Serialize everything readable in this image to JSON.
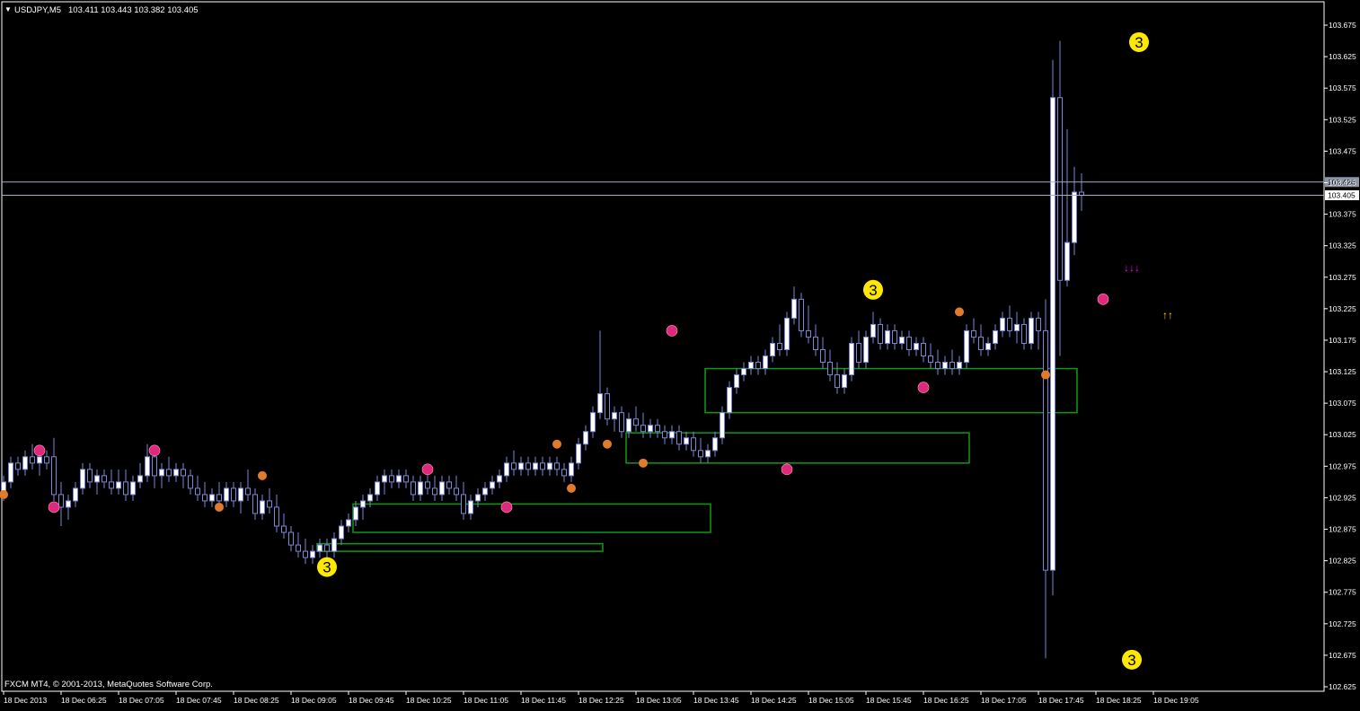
{
  "header": {
    "menu_glyph": "▼",
    "symbol": "USDJPY,M5",
    "quote": "103.411 103.443 103.382 103.405"
  },
  "footer": {
    "copyright": "FXCM MT4, © 2001-2013, MetaQuotes Software Corp."
  },
  "colors": {
    "background": "#000000",
    "grid_frame": "#ffffff",
    "candle": "#7d86d6",
    "bull_body": "#ffffff",
    "hline": "#a4b0c8",
    "zone": "#0c9a15",
    "wave_label": "#ffe800",
    "marker_pink": "#e0287c",
    "marker_orange": "#e07a2c",
    "arrow_down": "#ff00ff",
    "arrow_up": "#ffd400",
    "ask_label_bg": "#8c96a8",
    "bid_label_bg": "#ffffff"
  },
  "chart_data": {
    "type": "candlestick",
    "symbol": "USDJPY",
    "timeframe": "M5",
    "ylim": [
      102.625,
      103.7
    ],
    "y_ticks": [
      "103.675",
      "103.625",
      "103.575",
      "103.525",
      "103.475",
      "103.425",
      "103.375",
      "103.325",
      "103.275",
      "103.225",
      "103.175",
      "103.125",
      "103.075",
      "103.025",
      "102.975",
      "102.925",
      "102.875",
      "102.825",
      "102.775",
      "102.725",
      "102.675",
      "102.625"
    ],
    "x_ticks": [
      "18 Dec 2013",
      "18 Dec 06:25",
      "18 Dec 07:05",
      "18 Dec 07:45",
      "18 Dec 08:25",
      "18 Dec 09:05",
      "18 Dec 09:45",
      "18 Dec 10:25",
      "18 Dec 11:05",
      "18 Dec 11:45",
      "18 Dec 12:25",
      "18 Dec 13:05",
      "18 Dec 13:45",
      "18 Dec 14:25",
      "18 Dec 15:05",
      "18 Dec 15:45",
      "18 Dec 16:25",
      "18 Dec 17:05",
      "18 Dec 17:45",
      "18 Dec 18:25",
      "18 Dec 19:05"
    ],
    "bars_per_tick": 8,
    "price_lines": [
      {
        "name": "ask",
        "value": 103.426,
        "label": "103.426"
      },
      {
        "name": "bid",
        "value": 103.405,
        "label": "103.405"
      }
    ],
    "ohlc": [
      [
        102.93,
        102.96,
        102.92,
        102.95
      ],
      [
        102.95,
        102.99,
        102.94,
        102.98
      ],
      [
        102.98,
        102.99,
        102.96,
        102.97
      ],
      [
        102.97,
        103.0,
        102.96,
        102.99
      ],
      [
        102.99,
        103.01,
        102.97,
        102.98
      ],
      [
        102.98,
        103.0,
        102.96,
        102.99
      ],
      [
        102.99,
        103.0,
        102.97,
        102.98
      ],
      [
        102.99,
        103.02,
        102.92,
        102.93
      ],
      [
        102.93,
        102.95,
        102.88,
        102.91
      ],
      [
        102.91,
        102.93,
        102.89,
        102.92
      ],
      [
        102.92,
        102.95,
        102.91,
        102.94
      ],
      [
        102.94,
        102.98,
        102.93,
        102.97
      ],
      [
        102.97,
        102.98,
        102.94,
        102.95
      ],
      [
        102.95,
        102.97,
        102.93,
        102.96
      ],
      [
        102.96,
        102.97,
        102.94,
        102.95
      ],
      [
        102.95,
        102.97,
        102.93,
        102.94
      ],
      [
        102.94,
        102.97,
        102.93,
        102.95
      ],
      [
        102.95,
        102.97,
        102.92,
        102.93
      ],
      [
        102.93,
        102.96,
        102.92,
        102.95
      ],
      [
        102.95,
        102.98,
        102.94,
        102.96
      ],
      [
        102.96,
        103.01,
        102.95,
        102.99
      ],
      [
        102.99,
        103.0,
        102.94,
        102.96
      ],
      [
        102.96,
        102.98,
        102.94,
        102.97
      ],
      [
        102.97,
        102.99,
        102.95,
        102.96
      ],
      [
        102.96,
        102.98,
        102.95,
        102.97
      ],
      [
        102.97,
        102.98,
        102.94,
        102.96
      ],
      [
        102.96,
        102.97,
        102.93,
        102.94
      ],
      [
        102.94,
        102.96,
        102.92,
        102.93
      ],
      [
        102.93,
        102.95,
        102.91,
        102.92
      ],
      [
        102.92,
        102.94,
        102.91,
        102.93
      ],
      [
        102.93,
        102.95,
        102.91,
        102.92
      ],
      [
        102.92,
        102.95,
        102.91,
        102.94
      ],
      [
        102.94,
        102.95,
        102.91,
        102.92
      ],
      [
        102.92,
        102.95,
        102.9,
        102.94
      ],
      [
        102.94,
        102.97,
        102.92,
        102.93
      ],
      [
        102.93,
        102.94,
        102.89,
        102.9
      ],
      [
        102.9,
        102.93,
        102.89,
        102.92
      ],
      [
        102.92,
        102.94,
        102.9,
        102.91
      ],
      [
        102.91,
        102.93,
        102.87,
        102.88
      ],
      [
        102.88,
        102.9,
        102.86,
        102.87
      ],
      [
        102.87,
        102.88,
        102.84,
        102.85
      ],
      [
        102.85,
        102.87,
        102.83,
        102.84
      ],
      [
        102.84,
        102.86,
        102.82,
        102.83
      ],
      [
        102.83,
        102.85,
        102.82,
        102.84
      ],
      [
        102.84,
        102.86,
        102.83,
        102.85
      ],
      [
        102.85,
        102.86,
        102.83,
        102.84
      ],
      [
        102.84,
        102.87,
        102.83,
        102.86
      ],
      [
        102.86,
        102.89,
        102.85,
        102.88
      ],
      [
        102.88,
        102.9,
        102.87,
        102.89
      ],
      [
        102.89,
        102.92,
        102.88,
        102.91
      ],
      [
        102.91,
        102.93,
        102.89,
        102.92
      ],
      [
        102.92,
        102.94,
        102.91,
        102.93
      ],
      [
        102.93,
        102.96,
        102.92,
        102.95
      ],
      [
        102.95,
        102.97,
        102.93,
        102.96
      ],
      [
        102.96,
        102.97,
        102.94,
        102.95
      ],
      [
        102.95,
        102.97,
        102.94,
        102.96
      ],
      [
        102.96,
        102.97,
        102.94,
        102.95
      ],
      [
        102.95,
        102.96,
        102.92,
        102.93
      ],
      [
        102.93,
        102.96,
        102.92,
        102.95
      ],
      [
        102.95,
        102.97,
        102.93,
        102.94
      ],
      [
        102.94,
        102.96,
        102.92,
        102.93
      ],
      [
        102.93,
        102.96,
        102.92,
        102.95
      ],
      [
        102.95,
        102.96,
        102.93,
        102.94
      ],
      [
        102.94,
        102.96,
        102.92,
        102.93
      ],
      [
        102.93,
        102.95,
        102.89,
        102.9
      ],
      [
        102.9,
        102.93,
        102.89,
        102.92
      ],
      [
        102.92,
        102.94,
        102.91,
        102.93
      ],
      [
        102.93,
        102.95,
        102.92,
        102.94
      ],
      [
        102.94,
        102.96,
        102.93,
        102.95
      ],
      [
        102.95,
        102.97,
        102.94,
        102.96
      ],
      [
        102.96,
        102.99,
        102.95,
        102.98
      ],
      [
        102.98,
        103.0,
        102.96,
        102.97
      ],
      [
        102.97,
        102.99,
        102.96,
        102.98
      ],
      [
        102.98,
        102.99,
        102.96,
        102.97
      ],
      [
        102.97,
        102.99,
        102.96,
        102.98
      ],
      [
        102.98,
        102.99,
        102.96,
        102.97
      ],
      [
        102.97,
        102.99,
        102.96,
        102.98
      ],
      [
        102.98,
        102.99,
        102.96,
        102.97
      ],
      [
        102.97,
        102.98,
        102.95,
        102.96
      ],
      [
        102.96,
        102.99,
        102.95,
        102.98
      ],
      [
        102.98,
        103.02,
        102.97,
        103.01
      ],
      [
        103.01,
        103.04,
        103.0,
        103.03
      ],
      [
        103.03,
        103.07,
        103.02,
        103.06
      ],
      [
        103.06,
        103.19,
        103.05,
        103.09
      ],
      [
        103.09,
        103.1,
        103.04,
        103.05
      ],
      [
        103.05,
        103.07,
        103.03,
        103.06
      ],
      [
        103.06,
        103.07,
        103.02,
        103.03
      ],
      [
        103.03,
        103.06,
        103.02,
        103.05
      ],
      [
        103.05,
        103.07,
        103.03,
        103.04
      ],
      [
        103.04,
        103.06,
        103.02,
        103.03
      ],
      [
        103.03,
        103.05,
        103.02,
        103.04
      ],
      [
        103.04,
        103.05,
        103.02,
        103.03
      ],
      [
        103.03,
        103.04,
        103.01,
        103.02
      ],
      [
        103.02,
        103.04,
        103.01,
        103.03
      ],
      [
        103.03,
        103.04,
        103.0,
        103.01
      ],
      [
        103.01,
        103.03,
        103.0,
        103.02
      ],
      [
        103.02,
        103.03,
        102.99,
        103.0
      ],
      [
        103.0,
        103.02,
        102.98,
        102.99
      ],
      [
        102.99,
        103.01,
        102.98,
        103.0
      ],
      [
        103.0,
        103.03,
        102.99,
        103.02
      ],
      [
        103.02,
        103.07,
        103.01,
        103.06
      ],
      [
        103.06,
        103.11,
        103.05,
        103.1
      ],
      [
        103.1,
        103.13,
        103.09,
        103.12
      ],
      [
        103.12,
        103.14,
        103.11,
        103.13
      ],
      [
        103.13,
        103.15,
        103.12,
        103.14
      ],
      [
        103.14,
        103.15,
        103.12,
        103.13
      ],
      [
        103.13,
        103.16,
        103.12,
        103.15
      ],
      [
        103.15,
        103.18,
        103.14,
        103.17
      ],
      [
        103.17,
        103.2,
        103.15,
        103.16
      ],
      [
        103.16,
        103.22,
        103.15,
        103.21
      ],
      [
        103.21,
        103.26,
        103.2,
        103.24
      ],
      [
        103.24,
        103.25,
        103.18,
        103.19
      ],
      [
        103.19,
        103.23,
        103.17,
        103.18
      ],
      [
        103.18,
        103.2,
        103.15,
        103.16
      ],
      [
        103.16,
        103.18,
        103.13,
        103.14
      ],
      [
        103.14,
        103.16,
        103.11,
        103.12
      ],
      [
        103.12,
        103.14,
        103.09,
        103.1
      ],
      [
        103.1,
        103.13,
        103.09,
        103.12
      ],
      [
        103.12,
        103.18,
        103.11,
        103.17
      ],
      [
        103.17,
        103.19,
        103.13,
        103.14
      ],
      [
        103.14,
        103.19,
        103.13,
        103.18
      ],
      [
        103.18,
        103.22,
        103.17,
        103.2
      ],
      [
        103.2,
        103.21,
        103.16,
        103.17
      ],
      [
        103.17,
        103.2,
        103.16,
        103.19
      ],
      [
        103.19,
        103.2,
        103.16,
        103.17
      ],
      [
        103.17,
        103.19,
        103.16,
        103.18
      ],
      [
        103.18,
        103.19,
        103.15,
        103.16
      ],
      [
        103.16,
        103.18,
        103.15,
        103.17
      ],
      [
        103.17,
        103.18,
        103.14,
        103.15
      ],
      [
        103.15,
        103.17,
        103.13,
        103.14
      ],
      [
        103.14,
        103.16,
        103.12,
        103.13
      ],
      [
        103.13,
        103.15,
        103.12,
        103.14
      ],
      [
        103.14,
        103.16,
        103.12,
        103.13
      ],
      [
        103.13,
        103.15,
        103.12,
        103.14
      ],
      [
        103.14,
        103.2,
        103.13,
        103.19
      ],
      [
        103.19,
        103.21,
        103.17,
        103.18
      ],
      [
        103.18,
        103.2,
        103.15,
        103.16
      ],
      [
        103.16,
        103.18,
        103.15,
        103.17
      ],
      [
        103.17,
        103.2,
        103.16,
        103.19
      ],
      [
        103.19,
        103.22,
        103.18,
        103.21
      ],
      [
        103.21,
        103.23,
        103.18,
        103.19
      ],
      [
        103.19,
        103.22,
        103.17,
        103.2
      ],
      [
        103.2,
        103.21,
        103.16,
        103.17
      ],
      [
        103.17,
        103.22,
        103.16,
        103.21
      ],
      [
        103.21,
        103.22,
        103.16,
        103.19
      ],
      [
        103.19,
        103.24,
        102.67,
        102.81
      ],
      [
        102.81,
        103.62,
        102.77,
        103.56
      ],
      [
        103.56,
        103.65,
        103.15,
        103.27
      ],
      [
        103.27,
        103.51,
        103.26,
        103.33
      ],
      [
        103.33,
        103.45,
        103.31,
        103.41
      ],
      [
        103.41,
        103.44,
        103.38,
        103.405
      ]
    ],
    "wave_labels": [
      {
        "text": "3",
        "bar": 45,
        "price": 102.815,
        "below": true
      },
      {
        "text": "3",
        "bar": 121,
        "price": 103.255,
        "below": false
      },
      {
        "text": "3",
        "bar": 158,
        "price": 103.648,
        "below": false
      },
      {
        "text": "3",
        "bar": 157,
        "price": 102.668,
        "below": true
      }
    ],
    "markers": [
      {
        "bar": 5,
        "price": 103.0,
        "kind": "pink"
      },
      {
        "bar": 7,
        "price": 102.91,
        "kind": "pink"
      },
      {
        "bar": 21,
        "price": 103.0,
        "kind": "pink"
      },
      {
        "bar": 0,
        "price": 102.93,
        "kind": "orange"
      },
      {
        "bar": 30,
        "price": 102.91,
        "kind": "orange"
      },
      {
        "bar": 36,
        "price": 102.96,
        "kind": "orange"
      },
      {
        "bar": 59,
        "price": 102.97,
        "kind": "pink"
      },
      {
        "bar": 70,
        "price": 102.91,
        "kind": "pink"
      },
      {
        "bar": 77,
        "price": 103.01,
        "kind": "orange"
      },
      {
        "bar": 79,
        "price": 102.94,
        "kind": "orange"
      },
      {
        "bar": 84,
        "price": 103.01,
        "kind": "orange"
      },
      {
        "bar": 89,
        "price": 102.98,
        "kind": "orange"
      },
      {
        "bar": 93,
        "price": 103.19,
        "kind": "pink"
      },
      {
        "bar": 109,
        "price": 102.97,
        "kind": "pink"
      },
      {
        "bar": 128,
        "price": 103.1,
        "kind": "pink"
      },
      {
        "bar": 133,
        "price": 103.22,
        "kind": "orange"
      },
      {
        "bar": 145,
        "price": 103.12,
        "kind": "orange"
      },
      {
        "bar": 153,
        "price": 103.24,
        "kind": "pink"
      }
    ],
    "zones": [
      {
        "bar_start": 44,
        "bar_end": 83,
        "top": 102.852,
        "bottom": 102.84
      },
      {
        "bar_start": 49,
        "bar_end": 98,
        "top": 102.915,
        "bottom": 102.87
      },
      {
        "bar_start": 87,
        "bar_end": 134,
        "top": 103.028,
        "bottom": 102.98
      },
      {
        "bar_start": 98,
        "bar_end": 149,
        "top": 103.13,
        "bottom": 103.06
      }
    ],
    "arrows": [
      {
        "glyph": "↓↓↓",
        "bar": 157,
        "price": 103.29,
        "kind": "down"
      },
      {
        "glyph": "↑↑",
        "bar": 162,
        "price": 103.215,
        "kind": "up"
      }
    ]
  }
}
